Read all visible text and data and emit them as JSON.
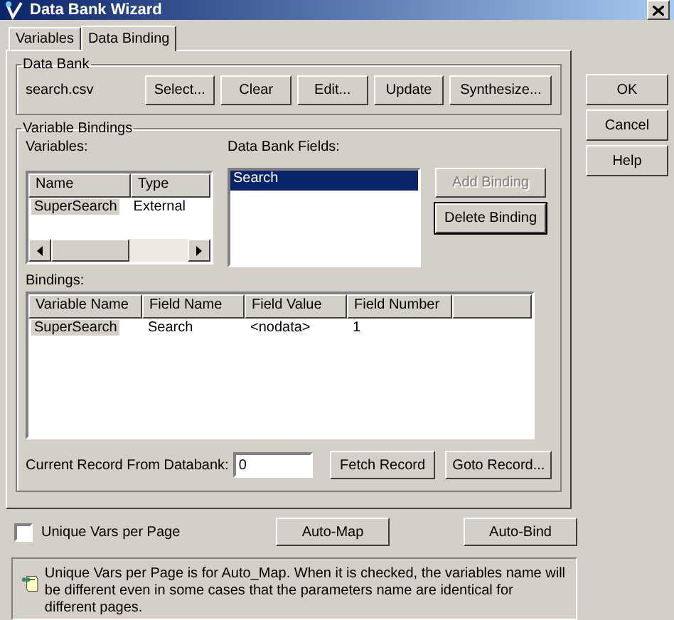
{
  "window": {
    "title": "Data Bank Wizard"
  },
  "tabs": [
    {
      "label": "Variables",
      "selected": false
    },
    {
      "label": "Data Binding",
      "selected": true
    }
  ],
  "data_bank": {
    "label": "Data Bank",
    "file": "search.csv",
    "buttons": [
      "Select...",
      "Clear",
      "Edit...",
      "Update",
      "Synthesize..."
    ]
  },
  "variable_bindings": {
    "label": "Variable Bindings",
    "variables_label": "Variables:",
    "variables_table": {
      "columns": [
        "Name",
        "Type"
      ],
      "rows": [
        {
          "cells": [
            "SuperSearch",
            "External"
          ],
          "selected": true
        }
      ]
    },
    "fields_label": "Data Bank Fields:",
    "fields": [
      {
        "label": "Search",
        "selected": true
      }
    ],
    "buttons": [
      {
        "label": "Add Binding",
        "disabled": true,
        "focused": false
      },
      {
        "label": "Delete Binding",
        "disabled": false,
        "focused": true
      }
    ],
    "bindings_label": "Bindings:",
    "bindings_table": {
      "columns": [
        "Variable Name",
        "Field Name",
        "Field Value",
        "Field Number"
      ],
      "rows": [
        {
          "cells": [
            "SuperSearch",
            "Search",
            "<nodata>",
            "1"
          ],
          "selected": true
        }
      ]
    },
    "current_record_label": "Current Record From Databank:",
    "current_record_value": "0",
    "record_buttons": [
      "Fetch Record",
      "Goto Record..."
    ]
  },
  "unique_vars": {
    "label": "Unique Vars per Page",
    "checked": false
  },
  "auto_buttons": [
    "Auto-Map",
    "Auto-Bind"
  ],
  "info": "Unique Vars per Page is for Auto_Map. When it is checked, the variables name will be different even in some cases that the parameters name are identical for different pages.",
  "side_buttons": [
    "OK",
    "Cancel",
    "Help"
  ]
}
